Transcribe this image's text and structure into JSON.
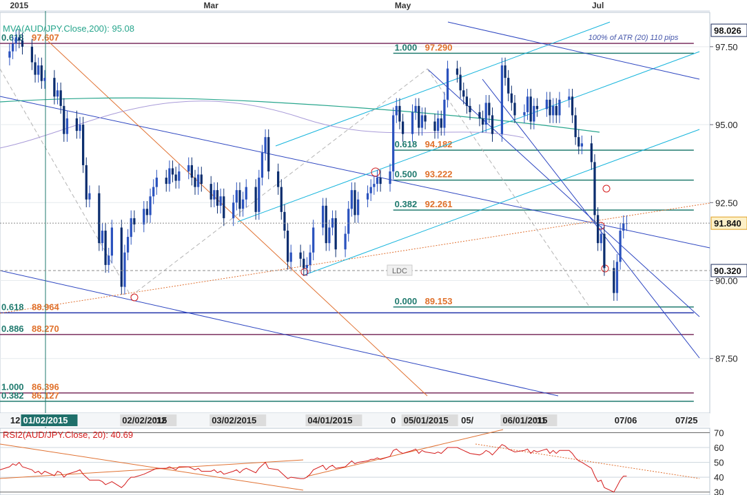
{
  "header": {
    "months": [
      {
        "label": "2015",
        "x": "2015-01-01"
      },
      {
        "label": "Mar",
        "x": "2015-03-02"
      },
      {
        "label": "May",
        "x": "2015-05-01"
      },
      {
        "label": "Jul",
        "x": "2015-07-01"
      }
    ]
  },
  "colors": {
    "up": "#2a52be",
    "down": "#0b2d6e",
    "fib_green": "#1f7a6e",
    "fib_purple": "#7a2e5e",
    "orange": "#e0702a",
    "cyan": "#14b4dc",
    "navy": "#2233aa",
    "rsi_line": "#d41a1a",
    "sma": "#26a58c",
    "purple_ma": "#a89ad8"
  },
  "chart_data": [
    {
      "type": "candlestick",
      "title": "MVA(AUD/JPY.Close,200): 95.08",
      "ylim": [
        85.75,
        98.6
      ],
      "y_ticks": [
        87.5,
        90.0,
        92.5,
        95.0,
        97.5
      ],
      "y_tick_labels": [
        "87.50",
        "90.00",
        "92.50",
        "95.00",
        "97.50"
      ],
      "price_badges": [
        {
          "label": "98.026",
          "value": 98.026,
          "style": "white"
        },
        {
          "label": "91.840",
          "value": 91.84,
          "style": "highlight"
        },
        {
          "label": "90.320",
          "value": 90.32,
          "style": "white"
        }
      ],
      "x_labels": [
        {
          "label": "12",
          "x": "2014-12-29",
          "style": "plain"
        },
        {
          "label": "01/02/2015",
          "x": "2015-01-02",
          "style": "dark"
        },
        {
          "label": "02/02/2015",
          "x": "2015-02-02",
          "style": "gray"
        },
        {
          "label": "'12",
          "x": "2015-02-12",
          "style": "plain"
        },
        {
          "label": "03/02/2015",
          "x": "2015-03-02",
          "style": "gray"
        },
        {
          "label": "04/01/2015",
          "x": "2015-04-01",
          "style": "gray"
        },
        {
          "label": "0",
          "x": "2015-04-27",
          "style": "plain"
        },
        {
          "label": "05/01/2015",
          "x": "2015-05-01",
          "style": "gray"
        },
        {
          "label": "05/",
          "x": "2015-05-19",
          "style": "plain"
        },
        {
          "label": "06/01/2015",
          "x": "2015-06-01",
          "style": "gray"
        },
        {
          "label": "'11",
          "x": "2015-06-11",
          "style": "plain"
        },
        {
          "label": "07/06",
          "x": "2015-07-06",
          "style": "plain"
        },
        {
          "label": "07/25",
          "x": "2015-07-25",
          "style": "plain"
        }
      ],
      "fib_levels": [
        {
          "ratio": "1.000",
          "price": "97.290",
          "value": 97.29,
          "color": "fib_green",
          "from": "2015-04-28",
          "to": "2015-07-31"
        },
        {
          "ratio": "0.618",
          "price": "94.182",
          "value": 94.182,
          "color": "fib_green",
          "from": "2015-04-28",
          "to": "2015-07-31"
        },
        {
          "ratio": "0.500",
          "price": "93.222",
          "value": 93.222,
          "color": "fib_green",
          "from": "2015-04-28",
          "to": "2015-07-31"
        },
        {
          "ratio": "0.382",
          "price": "92.261",
          "value": 92.261,
          "color": "fib_green",
          "from": "2015-04-28",
          "to": "2015-07-31"
        },
        {
          "ratio": "0.000",
          "price": "89.153",
          "value": 89.153,
          "color": "fib_green",
          "from": "2015-04-28",
          "to": "2015-07-31"
        },
        {
          "ratio": "0.618",
          "price": "97.607",
          "value": 97.607,
          "color": "fib_purple",
          "from": "2014-12-26",
          "to": "2015-07-31"
        },
        {
          "ratio": "0.618",
          "price": "88.964",
          "value": 88.964,
          "color": "navy",
          "from": "2014-12-26",
          "to": "2015-07-31"
        },
        {
          "ratio": "0.886",
          "price": "88.270",
          "value": 88.27,
          "color": "fib_purple",
          "from": "2014-12-26",
          "to": "2015-07-31"
        },
        {
          "ratio": "1.000",
          "price": "86.396",
          "value": 86.396,
          "color": "fib_purple",
          "from": "2014-12-26",
          "to": "2015-07-31"
        },
        {
          "ratio": "0.382",
          "price": "86.127",
          "value": 86.127,
          "color": "fib_green",
          "from": "2014-12-26",
          "to": "2015-07-31"
        }
      ],
      "annotations": [
        {
          "text": "100% of ATR (20) 110 pips",
          "x": "2015-06-28",
          "y": 97.72
        },
        {
          "text": "LDC",
          "x": "2015-04-30",
          "y": 90.32
        }
      ],
      "dates": [
        "2014-12-26",
        "2014-12-29",
        "2014-12-30",
        "2014-12-31",
        "2015-01-01",
        "2015-01-02",
        "2015-01-05",
        "2015-01-06",
        "2015-01-07",
        "2015-01-08",
        "2015-01-09",
        "2015-01-12",
        "2015-01-13",
        "2015-01-14",
        "2015-01-15",
        "2015-01-16",
        "2015-01-19",
        "2015-01-20",
        "2015-01-21",
        "2015-01-22",
        "2015-01-23",
        "2015-01-26",
        "2015-01-27",
        "2015-01-28",
        "2015-01-29",
        "2015-01-30",
        "2015-02-02",
        "2015-02-03",
        "2015-02-04",
        "2015-02-05",
        "2015-02-06",
        "2015-02-09",
        "2015-02-10",
        "2015-02-11",
        "2015-02-12",
        "2015-02-13",
        "2015-02-16",
        "2015-02-17",
        "2015-02-18",
        "2015-02-19",
        "2015-02-20",
        "2015-02-23",
        "2015-02-24",
        "2015-02-25",
        "2015-02-26",
        "2015-02-27",
        "2015-03-02",
        "2015-03-03",
        "2015-03-04",
        "2015-03-05",
        "2015-03-06",
        "2015-03-09",
        "2015-03-10",
        "2015-03-11",
        "2015-03-12",
        "2015-03-13",
        "2015-03-16",
        "2015-03-17",
        "2015-03-18",
        "2015-03-19",
        "2015-03-20",
        "2015-03-23",
        "2015-03-24",
        "2015-03-25",
        "2015-03-26",
        "2015-03-27",
        "2015-03-30",
        "2015-03-31",
        "2015-04-01",
        "2015-04-02",
        "2015-04-03",
        "2015-04-06",
        "2015-04-07",
        "2015-04-08",
        "2015-04-09",
        "2015-04-10",
        "2015-04-13",
        "2015-04-14",
        "2015-04-15",
        "2015-04-16",
        "2015-04-17",
        "2015-04-20",
        "2015-04-21",
        "2015-04-22",
        "2015-04-23",
        "2015-04-24",
        "2015-04-27",
        "2015-04-28",
        "2015-04-29",
        "2015-04-30",
        "2015-05-01",
        "2015-05-04",
        "2015-05-05",
        "2015-05-06",
        "2015-05-07",
        "2015-05-08",
        "2015-05-11",
        "2015-05-12",
        "2015-05-13",
        "2015-05-14",
        "2015-05-15",
        "2015-05-18",
        "2015-05-19",
        "2015-05-20",
        "2015-05-21",
        "2015-05-22",
        "2015-05-25",
        "2015-05-26",
        "2015-05-27",
        "2015-05-28",
        "2015-05-29",
        "2015-06-01",
        "2015-06-02",
        "2015-06-03",
        "2015-06-04",
        "2015-06-05",
        "2015-06-08",
        "2015-06-09",
        "2015-06-10",
        "2015-06-11",
        "2015-06-12",
        "2015-06-15",
        "2015-06-16",
        "2015-06-17",
        "2015-06-18",
        "2015-06-19",
        "2015-06-22",
        "2015-06-23",
        "2015-06-24",
        "2015-06-25",
        "2015-06-26",
        "2015-06-29",
        "2015-06-30",
        "2015-07-01",
        "2015-07-02",
        "2015-07-03",
        "2015-07-06",
        "2015-07-07",
        "2015-07-08",
        "2015-07-09",
        "2015-07-10"
      ],
      "close": [
        97.15,
        97.35,
        97.6,
        97.8,
        97.7,
        97.5,
        97.0,
        96.6,
        96.9,
        96.4,
        96.5,
        95.9,
        96.1,
        95.6,
        94.7,
        95.2,
        94.8,
        95.0,
        93.7,
        92.6,
        92.8,
        91.2,
        91.6,
        90.5,
        90.8,
        91.7,
        89.8,
        90.9,
        91.4,
        92.0,
        91.8,
        92.3,
        92.1,
        92.7,
        93.0,
        93.3,
        93.1,
        93.6,
        93.4,
        93.2,
        93.5,
        93.7,
        93.3,
        93.0,
        93.4,
        93.1,
        92.6,
        92.9,
        92.4,
        92.7,
        92.0,
        92.5,
        92.9,
        92.3,
        92.6,
        93.0,
        92.2,
        93.3,
        94.1,
        94.6,
        93.5,
        93.0,
        92.2,
        91.6,
        90.6,
        90.9,
        90.7,
        90.4,
        90.5,
        90.9,
        91.7,
        92.4,
        91.2,
        91.7,
        92.0,
        91.0,
        91.5,
        92.3,
        92.9,
        92.1,
        92.6,
        92.8,
        93.0,
        93.1,
        93.3,
        93.1,
        93.5,
        95.3,
        95.6,
        95.1,
        94.7,
        95.4,
        95.6,
        94.9,
        95.3,
        95.1,
        94.8,
        95.2,
        94.9,
        95.8,
        96.8,
        96.6,
        96.1,
        95.9,
        95.6,
        95.4,
        95.2,
        95.0,
        95.7,
        95.3,
        94.7,
        96.9,
        96.5,
        96.0,
        95.7,
        95.3,
        95.4,
        95.9,
        95.1,
        95.6,
        95.5,
        95.8,
        95.3,
        95.6,
        95.3,
        95.8,
        95.9,
        95.3,
        94.6,
        94.3,
        94.4,
        93.8,
        92.1,
        91.2,
        91.5,
        90.4,
        89.6,
        90.6,
        91.6,
        91.84,
        91.84
      ],
      "bar_half_width_days": 0.35
    },
    {
      "type": "line",
      "title": "RSI2(AUD/JPY.Close, 20): 40.69",
      "ylim": [
        28,
        73
      ],
      "y_ticks": [
        30,
        40,
        50,
        60,
        70
      ],
      "y_tick_labels": [
        "30",
        "40",
        "50",
        "60",
        "70"
      ],
      "series": [
        {
          "name": "RSI2(AUD/JPY.Close, 20)",
          "x_start": "2014-12-26",
          "values": [
            45,
            47,
            49,
            48,
            50,
            47,
            45,
            43,
            44,
            42,
            44,
            41,
            44,
            43,
            40,
            42,
            44,
            45,
            42,
            40,
            38,
            38,
            37,
            35,
            36,
            37,
            33,
            35,
            38,
            40,
            40,
            42,
            43,
            44,
            45,
            46,
            46,
            47,
            46,
            45,
            47,
            47,
            46,
            45,
            46,
            44,
            44,
            45,
            43,
            44,
            42,
            44,
            45,
            43,
            45,
            46,
            43,
            46,
            48,
            50,
            46,
            45,
            43,
            41,
            39,
            40,
            39,
            39,
            40,
            42,
            45,
            48,
            45,
            47,
            48,
            46,
            47,
            49,
            51,
            49,
            50,
            51,
            52,
            52,
            53,
            52,
            54,
            58,
            59,
            57,
            56,
            58,
            59,
            56,
            58,
            57,
            56,
            57,
            56,
            58,
            60,
            60,
            59,
            58,
            57,
            56,
            55,
            56,
            58,
            57,
            55,
            62,
            61,
            59,
            58,
            57,
            58,
            59,
            56,
            58,
            57,
            59,
            56,
            58,
            56,
            58,
            58,
            56,
            53,
            51,
            50,
            46,
            41,
            37,
            38,
            33,
            30,
            34,
            38,
            40.69,
            40.69
          ]
        }
      ]
    }
  ]
}
